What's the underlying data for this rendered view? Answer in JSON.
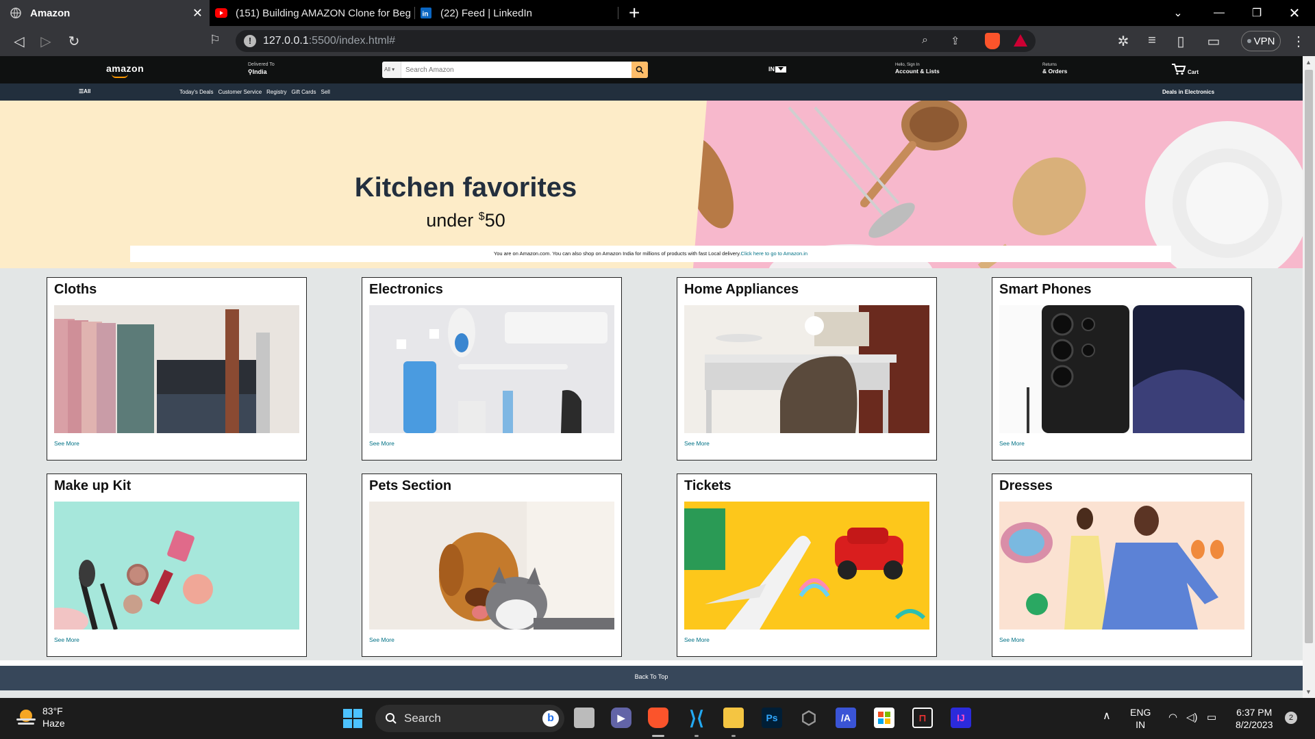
{
  "browser": {
    "tabs": [
      {
        "title": "Amazon",
        "active": true
      },
      {
        "title": "(151) Building AMAZON Clone for Beg",
        "active": false
      },
      {
        "title": "(22) Feed | LinkedIn",
        "active": false
      }
    ],
    "url_host": "127.0.0.1",
    "url_rest": ":5500/index.html#",
    "vpn_label": "VPN"
  },
  "header": {
    "logo": "amazon",
    "deliver_line1": "Delivered To",
    "deliver_line2": "India",
    "search_category": "All",
    "search_placeholder": "Search Amazon",
    "lang": "IN",
    "account_line1": "Hello, Sign In",
    "account_line2": "Account & Lists",
    "returns_line1": "Returns",
    "returns_line2": "& Orders",
    "cart": "Cart"
  },
  "subnav": {
    "all": "All",
    "links": [
      "Today's Deals",
      "Customer Service",
      "Registry",
      "Gift Cards",
      "Sell"
    ],
    "deals": "Deals in Electronics"
  },
  "hero": {
    "title": "Kitchen favorites",
    "subtitle_prefix": "under ",
    "subtitle_currency": "$",
    "subtitle_amount": "50",
    "notice_text": "You are on Amazon.com. You can also shop on Amazon India for millions of products with fast Local delivery.",
    "notice_link": "Click here to go to Amazon.in"
  },
  "products": [
    {
      "title": "Cloths",
      "link": "See More"
    },
    {
      "title": "Electronics",
      "link": "See More"
    },
    {
      "title": "Home Appliances",
      "link": "See More"
    },
    {
      "title": "Smart Phones",
      "link": "See More"
    },
    {
      "title": "Make up Kit",
      "link": "See More"
    },
    {
      "title": "Pets Section",
      "link": "See More"
    },
    {
      "title": "Tickets",
      "link": "See More"
    },
    {
      "title": "Dresses",
      "link": "See More"
    }
  ],
  "footer": {
    "back_to_top": "Back To Top"
  },
  "taskbar": {
    "temp": "83°F",
    "condition": "Haze",
    "search": "Search",
    "lang1": "ENG",
    "lang2": "IN",
    "time": "6:37 PM",
    "date": "8/2/2023",
    "notifications": "2"
  },
  "colors": {
    "amazon_dark": "#0f1111",
    "amazon_sub": "#222f3d",
    "amazon_orange": "#febd69",
    "hero_cream": "#fdecc8",
    "hero_pink": "#f7b8cc",
    "link_teal": "#007185",
    "back_to_top": "#37475a"
  }
}
